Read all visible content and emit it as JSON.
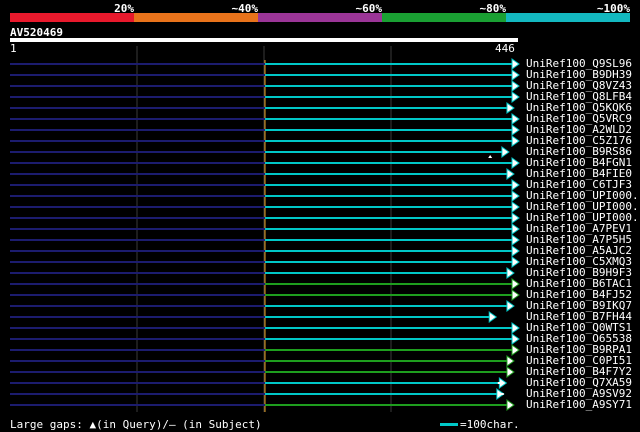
{
  "query": {
    "name": "AV520469",
    "start": "1",
    "end": "446"
  },
  "scale": {
    "labels": [
      "20%",
      "~40%",
      "~60%",
      "~80%",
      "~100%"
    ],
    "colors": [
      "#e8192c",
      "#e8731b",
      "#9b3597",
      "#1aa033",
      "#13b8c0"
    ]
  },
  "colors": {
    "cyan": "#00c8c8",
    "green": "#1e9e1e",
    "navy": "#1c1c6e",
    "mark": "#ffffff"
  },
  "hits": [
    {
      "label": "UniRef100_Q9SL96",
      "end_pct": 1.0,
      "color": "cyan",
      "arrow": "white"
    },
    {
      "label": "UniRef100_B9DH39",
      "end_pct": 1.0,
      "color": "cyan",
      "arrow": "white"
    },
    {
      "label": "UniRef100_Q8VZ43",
      "end_pct": 1.0,
      "color": "cyan",
      "arrow": "white"
    },
    {
      "label": "UniRef100_Q8LFB4",
      "end_pct": 1.0,
      "color": "cyan",
      "arrow": "white"
    },
    {
      "label": "UniRef100_Q5KQK6",
      "end_pct": 0.98,
      "color": "cyan",
      "arrow": "white"
    },
    {
      "label": "UniRef100_Q5VRC9",
      "end_pct": 1.0,
      "color": "cyan",
      "arrow": "white"
    },
    {
      "label": "UniRef100_A2WLD2",
      "end_pct": 1.0,
      "color": "cyan",
      "arrow": "white"
    },
    {
      "label": "UniRef100_C5Z176",
      "end_pct": 1.0,
      "color": "cyan",
      "arrow": "white"
    },
    {
      "label": "UniRef100_B9RS86",
      "end_pct": 0.96,
      "color": "cyan",
      "arrow": "white",
      "mark": 0.89
    },
    {
      "label": "UniRef100_B4FGN1",
      "end_pct": 1.0,
      "color": "cyan",
      "arrow": "white"
    },
    {
      "label": "UniRef100_B4FIE0",
      "end_pct": 0.98,
      "color": "cyan",
      "arrow": "white"
    },
    {
      "label": "UniRef100_C6TJF3",
      "end_pct": 1.0,
      "color": "cyan",
      "arrow": "white"
    },
    {
      "label": "UniRef100_UPI000..",
      "end_pct": 1.0,
      "color": "cyan",
      "arrow": "white"
    },
    {
      "label": "UniRef100_UPI000..",
      "end_pct": 1.0,
      "color": "cyan",
      "arrow": "white"
    },
    {
      "label": "UniRef100_UPI000..",
      "end_pct": 1.0,
      "color": "cyan",
      "arrow": "white"
    },
    {
      "label": "UniRef100_A7PEV1",
      "end_pct": 1.0,
      "color": "cyan",
      "arrow": "white"
    },
    {
      "label": "UniRef100_A7P5H5",
      "end_pct": 1.0,
      "color": "cyan",
      "arrow": "white"
    },
    {
      "label": "UniRef100_A5AJC2",
      "end_pct": 1.0,
      "color": "cyan",
      "arrow": "white"
    },
    {
      "label": "UniRef100_C5XMQ3",
      "end_pct": 1.0,
      "color": "cyan",
      "arrow": "white"
    },
    {
      "label": "UniRef100_B9H9F3",
      "end_pct": 0.98,
      "color": "cyan",
      "arrow": "white"
    },
    {
      "label": "UniRef100_B6TAC1",
      "end_pct": 1.0,
      "color": "green",
      "arrow": "white"
    },
    {
      "label": "UniRef100_B4FJ52",
      "end_pct": 1.0,
      "color": "green",
      "arrow": "white"
    },
    {
      "label": "UniRef100_B9IKQ7",
      "end_pct": 0.98,
      "color": "cyan",
      "arrow": "white"
    },
    {
      "label": "UniRef100_B7FH44",
      "end_pct": 0.91,
      "color": "cyan",
      "arrow": "white"
    },
    {
      "label": "UniRef100_Q0WTS1",
      "end_pct": 1.0,
      "color": "cyan",
      "arrow": "white"
    },
    {
      "label": "UniRef100_O65538",
      "end_pct": 1.0,
      "color": "cyan",
      "arrow": "white"
    },
    {
      "label": "UniRef100_B9RPA1",
      "end_pct": 1.0,
      "color": "green",
      "arrow": "white"
    },
    {
      "label": "UniRef100_C0PI51",
      "end_pct": 0.98,
      "color": "green",
      "arrow": "white"
    },
    {
      "label": "UniRef100_B4F7Y2",
      "end_pct": 0.98,
      "color": "green",
      "arrow": "white"
    },
    {
      "label": "UniRef100_Q7XA59",
      "end_pct": 0.95,
      "color": "cyan",
      "arrow": "white",
      "gap": 0.92
    },
    {
      "label": "UniRef100_A9SV92",
      "end_pct": 0.94,
      "color": "cyan",
      "arrow": "white",
      "gap": 0.92
    },
    {
      "label": "UniRef100_A9SY71",
      "end_pct": 0.98,
      "color": "green",
      "arrow": "white"
    }
  ],
  "footer": {
    "gaps_text": "Large gaps: ▲(in Query)/– (in Subject)",
    "key_text": "=100char."
  }
}
